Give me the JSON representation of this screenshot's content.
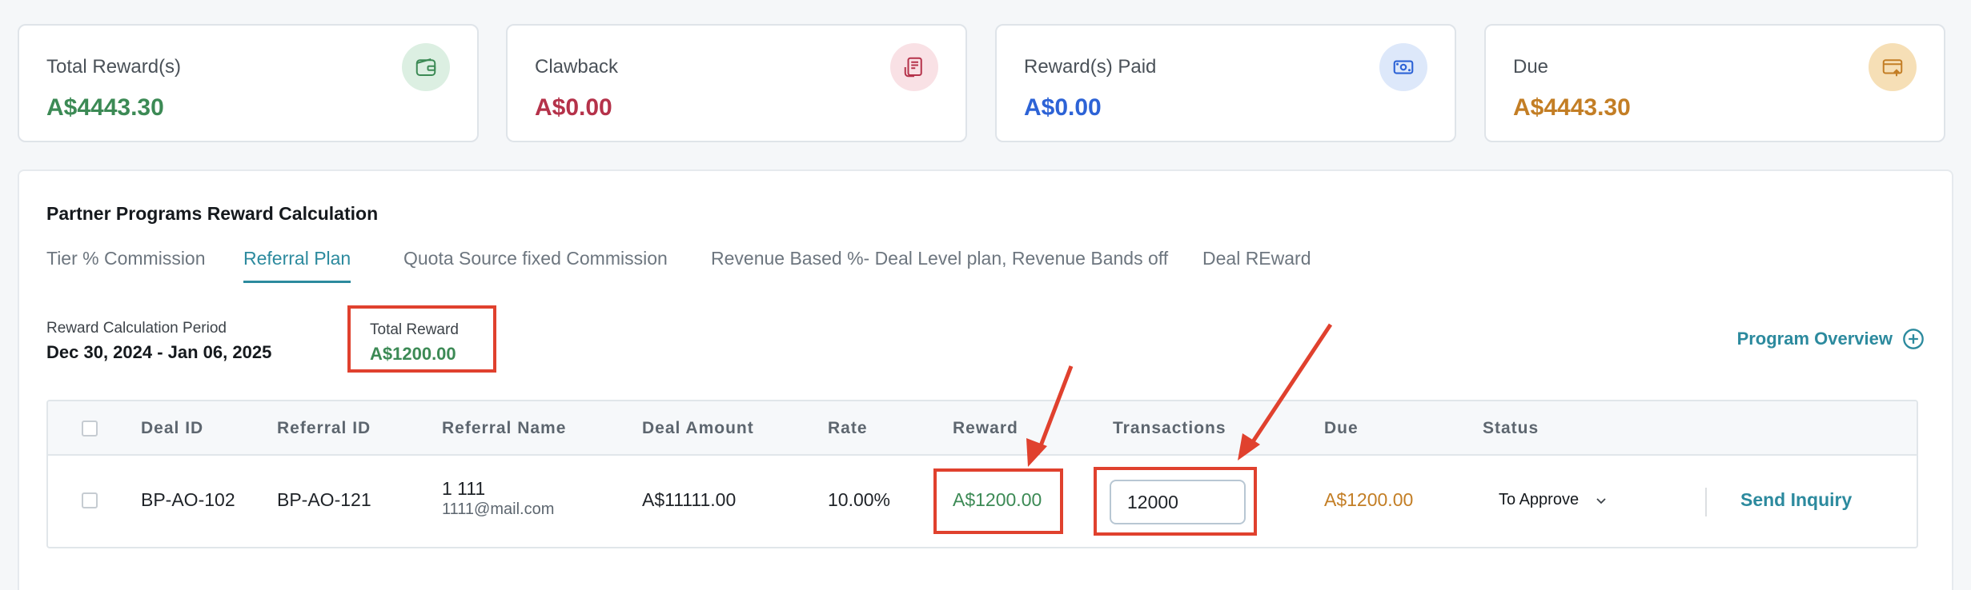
{
  "cards": [
    {
      "label": "Total Reward(s)",
      "value": "A$4443.30",
      "color": "#3c8a55",
      "icon": "wallet-icon",
      "icon_bg": "#dcefe2"
    },
    {
      "label": "Clawback",
      "value": "A$0.00",
      "color": "#b5324a",
      "icon": "receipt-icon",
      "icon_bg": "#f9e1e5"
    },
    {
      "label": "Reward(s) Paid",
      "value": "A$0.00",
      "color": "#2d63d6",
      "icon": "cash-icon",
      "icon_bg": "#dde8fa"
    },
    {
      "label": "Due",
      "value": "A$4443.30",
      "color": "#c37e25",
      "icon": "card-upload-icon",
      "icon_bg": "#f6dfb6"
    }
  ],
  "panel": {
    "title": "Partner Programs Reward Calculation",
    "tabs": [
      {
        "label": "Tier % Commission",
        "active": false
      },
      {
        "label": "Referral Plan",
        "active": true
      },
      {
        "label": "Quota Source fixed Commission",
        "active": false
      },
      {
        "label": "Revenue Based %- Deal Level plan, Revenue Bands off",
        "active": false
      },
      {
        "label": "Deal REward",
        "active": false
      }
    ],
    "period_label": "Reward Calculation Period",
    "period_value": "Dec 30, 2024 - Jan 06, 2025",
    "total_label": "Total Reward",
    "total_value": "A$1200.00",
    "overview_label": "Program Overview"
  },
  "table": {
    "headers": [
      "Deal ID",
      "Referral ID",
      "Referral Name",
      "Deal Amount",
      "Rate",
      "Reward",
      "Transactions",
      "Due",
      "Status"
    ],
    "rows": [
      {
        "deal_id": "BP-AO-102",
        "referral_id": "BP-AO-121",
        "referral_name": "1 111",
        "referral_email": "1111@mail.com",
        "deal_amount": "A$11111.00",
        "rate": "10.00%",
        "reward": "A$1200.00",
        "transactions": "12000",
        "due": "A$1200.00",
        "status": "To Approve",
        "action": "Send Inquiry"
      }
    ]
  },
  "colors": {
    "accent": "#2c8a9e",
    "green": "#3c8a55",
    "orange": "#c37e25",
    "highlight": "#e0412e"
  }
}
